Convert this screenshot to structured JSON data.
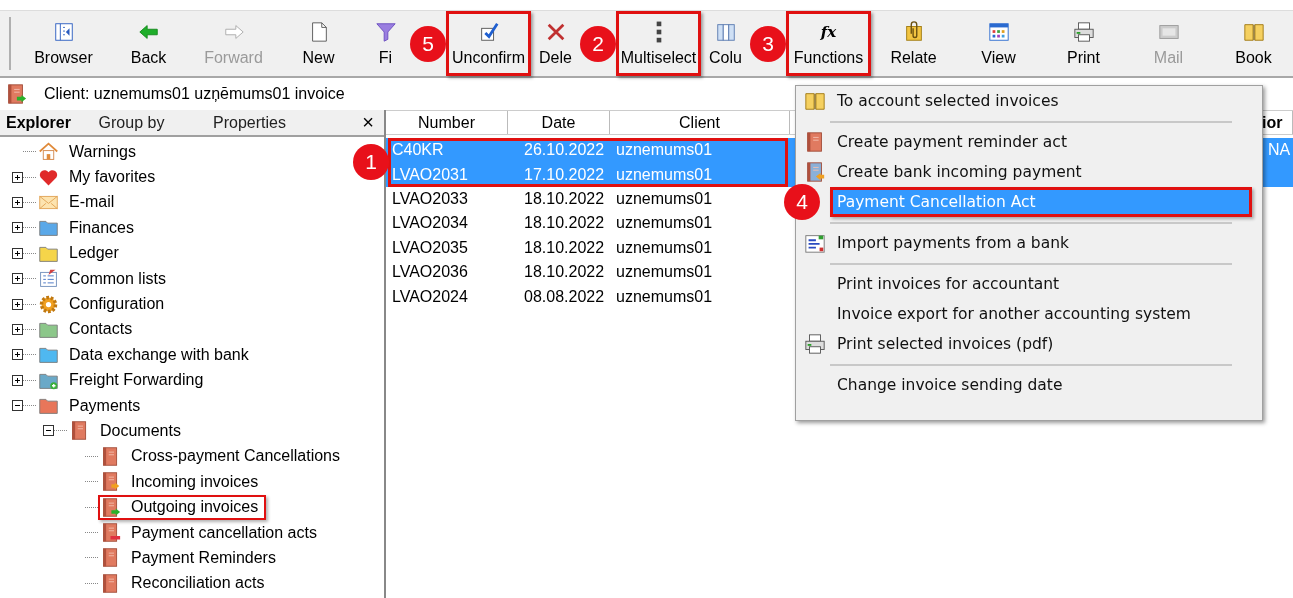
{
  "toolbar": {
    "buttons": [
      {
        "label": "Browser",
        "disabled": false,
        "highlighted": false
      },
      {
        "label": "Back",
        "disabled": false,
        "highlighted": false
      },
      {
        "label": "Forward",
        "disabled": true,
        "highlighted": false
      },
      {
        "label": "New",
        "disabled": false,
        "highlighted": false
      },
      {
        "label": "Fi",
        "disabled": false,
        "highlighted": false
      },
      {
        "label": "Unconfirm",
        "disabled": false,
        "highlighted": true,
        "callout": "5"
      },
      {
        "label": "Dele",
        "disabled": false,
        "highlighted": false
      },
      {
        "label": "Multiselect",
        "disabled": false,
        "highlighted": true,
        "callout": "2"
      },
      {
        "label": "Colu",
        "disabled": false,
        "highlighted": false
      },
      {
        "label": "Functions",
        "glyph": "fx",
        "disabled": false,
        "highlighted": true,
        "callout": "3"
      },
      {
        "label": "Relate",
        "disabled": false,
        "highlighted": false
      },
      {
        "label": "View",
        "disabled": false,
        "highlighted": false
      },
      {
        "label": "Print",
        "disabled": false,
        "highlighted": false
      },
      {
        "label": "Mail",
        "disabled": true,
        "highlighted": false
      },
      {
        "label": "Book",
        "disabled": false,
        "highlighted": false
      }
    ]
  },
  "client_bar": {
    "text": "Client: uznemums01 uzņēmums01 invoice"
  },
  "explorer": {
    "tabs": [
      {
        "label": "Explorer",
        "selected": true
      },
      {
        "label": "Group by",
        "selected": false
      },
      {
        "label": "Properties",
        "selected": false
      }
    ],
    "close": "×",
    "tree": [
      {
        "label": "Warnings",
        "kind": "house"
      },
      {
        "label": "My favorites",
        "kind": "heart",
        "expanded": false
      },
      {
        "label": "E-mail",
        "kind": "envelope",
        "expanded": false
      },
      {
        "label": "Finances",
        "kind": "folder",
        "color": "#5aa8e8",
        "expanded": false
      },
      {
        "label": "Ledger",
        "kind": "folder",
        "color": "#f5d54a",
        "expanded": false
      },
      {
        "label": "Common lists",
        "kind": "list",
        "expanded": false
      },
      {
        "label": "Configuration",
        "kind": "gear",
        "expanded": false
      },
      {
        "label": "Contacts",
        "kind": "folder",
        "color": "#8cc78a",
        "expanded": false
      },
      {
        "label": "Data exchange with bank",
        "kind": "folder",
        "color": "#4fb8f0",
        "expanded": false
      },
      {
        "label": "Freight Forwarding",
        "kind": "folder-plus",
        "color": "#6aa9c8",
        "expanded": false
      },
      {
        "label": "Payments",
        "kind": "folder",
        "color": "#e8765a",
        "expanded": true,
        "children": [
          {
            "label": "Documents",
            "kind": "book",
            "expanded": true,
            "children": [
              {
                "label": "Cross-payment Cancellations",
                "kind": "book",
                "highlighted": false
              },
              {
                "label": "Incoming invoices",
                "kind": "book-in",
                "highlighted": false
              },
              {
                "label": "Outgoing invoices",
                "kind": "book-out",
                "highlighted": true
              },
              {
                "label": "Payment cancellation acts",
                "kind": "book-minus",
                "highlighted": false
              },
              {
                "label": "Payment Reminders",
                "kind": "book",
                "highlighted": false
              },
              {
                "label": "Reconciliation acts",
                "kind": "book",
                "highlighted": false
              }
            ]
          }
        ]
      }
    ]
  },
  "table": {
    "columns": [
      "Number",
      "Date",
      "Client",
      "ior"
    ],
    "callout": "1",
    "rows": [
      {
        "cells": [
          "C40KR",
          "26.10.2022",
          "uznemums01",
          "NA"
        ],
        "selected": true,
        "highlighted": true
      },
      {
        "cells": [
          "LVAO2031",
          "17.10.2022",
          "uznemums01"
        ],
        "selected": true,
        "highlighted": true
      },
      {
        "cells": [
          "LVAO2033",
          "18.10.2022",
          "uznemums01"
        ],
        "selected": false,
        "highlighted": false
      },
      {
        "cells": [
          "LVAO2034",
          "18.10.2022",
          "uznemums01"
        ],
        "selected": false,
        "highlighted": false
      },
      {
        "cells": [
          "LVAO2035",
          "18.10.2022",
          "uznemums01"
        ],
        "selected": false,
        "highlighted": false
      },
      {
        "cells": [
          "LVAO2036",
          "18.10.2022",
          "uznemums01"
        ],
        "selected": false,
        "highlighted": false
      },
      {
        "cells": [
          "LVAO2024",
          "08.08.2022",
          "uznemums01"
        ],
        "selected": false,
        "highlighted": false
      }
    ]
  },
  "functions_menu": {
    "items": [
      {
        "kind": "item",
        "label": "To account selected invoices",
        "selected": false,
        "highlighted": false
      },
      {
        "kind": "separator"
      },
      {
        "kind": "item",
        "label": "Create payment reminder act",
        "selected": false,
        "highlighted": false
      },
      {
        "kind": "item",
        "label": "Create bank incoming payment",
        "selected": false,
        "highlighted": false
      },
      {
        "kind": "item",
        "label": "Payment Cancellation Act",
        "selected": true,
        "highlighted": true,
        "callout": "4"
      },
      {
        "kind": "separator"
      },
      {
        "kind": "item",
        "label": "Import payments from a bank",
        "selected": false,
        "highlighted": false
      },
      {
        "kind": "separator"
      },
      {
        "kind": "item",
        "label": "Print invoices for accountant",
        "selected": false,
        "highlighted": false
      },
      {
        "kind": "item",
        "label": "Invoice export for another accounting system",
        "selected": false,
        "highlighted": false
      },
      {
        "kind": "item",
        "label": "Print selected invoices (pdf)",
        "selected": false,
        "highlighted": false
      },
      {
        "kind": "separator"
      },
      {
        "kind": "item",
        "label": "Change invoice sending date",
        "selected": false,
        "highlighted": false
      }
    ]
  }
}
